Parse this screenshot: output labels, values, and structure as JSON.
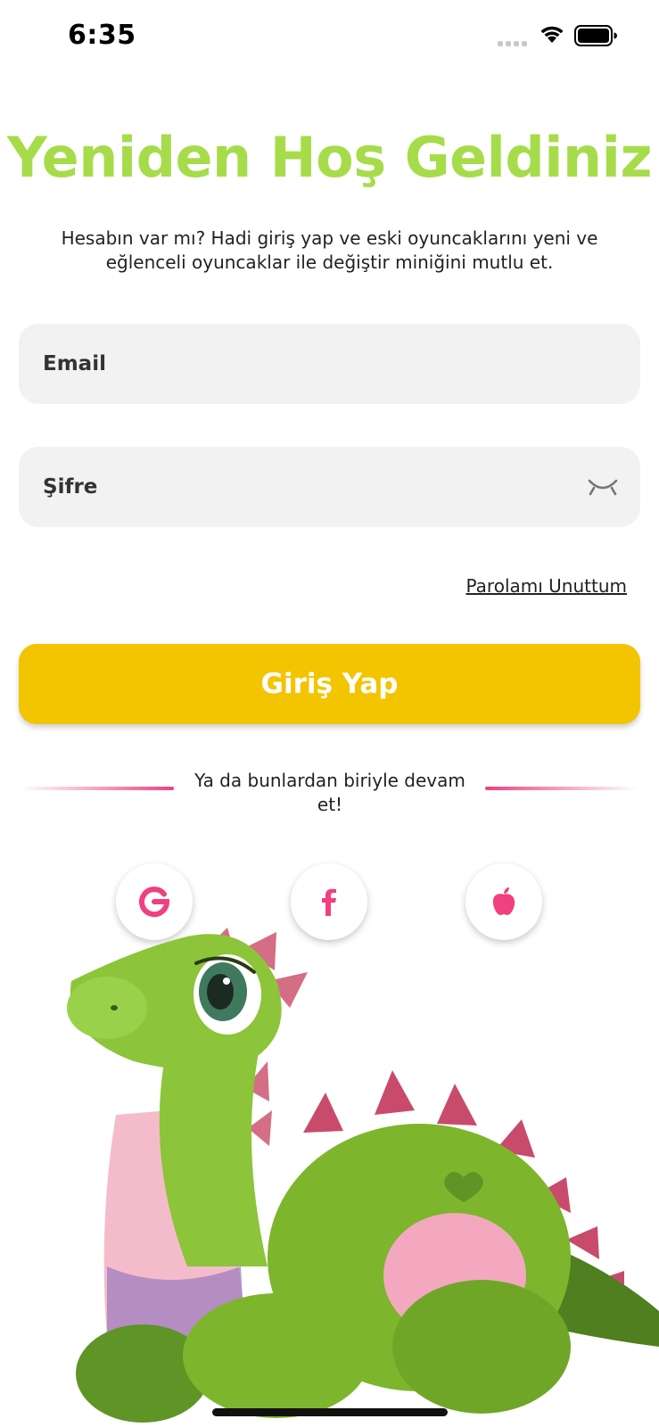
{
  "status_bar": {
    "time": "6:35"
  },
  "header": {
    "title": "Yeniden Hoş Geldiniz",
    "subtitle": "Hesabın var mı? Hadi giriş yap ve eski oyuncaklarını yeni ve eğlenceli oyuncaklar ile değiştir miniğini mutlu et."
  },
  "form": {
    "email_placeholder": "Email",
    "password_placeholder": "Şifre",
    "forgot_label": "Parolamı Unuttum",
    "login_label": "Giriş Yap"
  },
  "social": {
    "divider_text": "Ya da bunlardan biriyle devam et!",
    "providers": [
      "google-icon",
      "facebook-icon",
      "apple-icon"
    ]
  },
  "colors": {
    "title_green": "#a6dc4a",
    "button_yellow": "#f3c400",
    "accent_pink": "#f0407f",
    "field_bg": "#f2f2f2"
  }
}
